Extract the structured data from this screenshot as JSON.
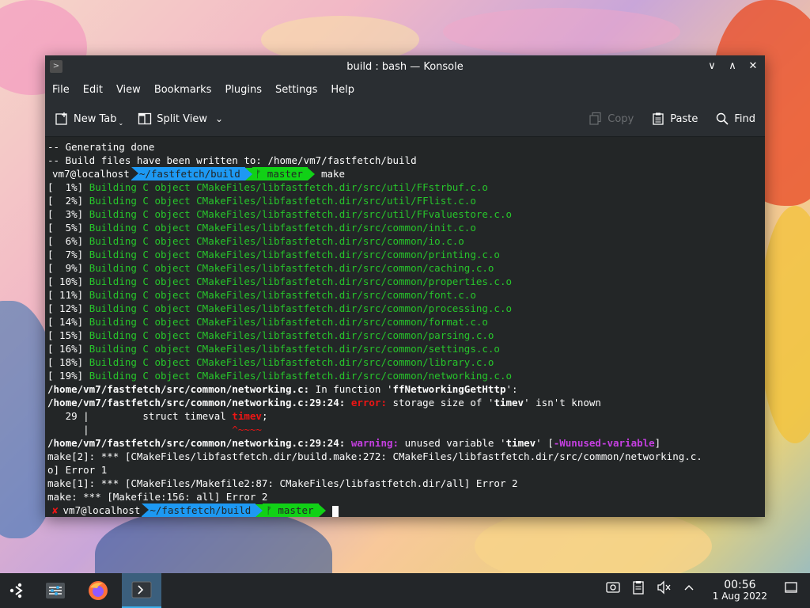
{
  "window": {
    "title": "build : bash — Konsole",
    "controls": [
      "∨",
      "∧",
      "✕"
    ]
  },
  "menu": [
    "File",
    "Edit",
    "View",
    "Bookmarks",
    "Plugins",
    "Settings",
    "Help"
  ],
  "toolbar": {
    "new_tab": "New Tab",
    "split_view": "Split View",
    "copy": "Copy",
    "paste": "Paste",
    "find": "Find"
  },
  "terminal": {
    "pre_lines": [
      "-- Generating done",
      "-- Build files have been written to: /home/vm7/fastfetch/build"
    ],
    "prompt1": {
      "user": "vm7@localhost",
      "dir": "~/fastfetch/build",
      "git": "ᚠ master",
      "cmd": "make"
    },
    "build_lines": [
      {
        "pct": "[  1%]",
        "text": "Building C object CMakeFiles/libfastfetch.dir/src/util/FFstrbuf.c.o"
      },
      {
        "pct": "[  2%]",
        "text": "Building C object CMakeFiles/libfastfetch.dir/src/util/FFlist.c.o"
      },
      {
        "pct": "[  3%]",
        "text": "Building C object CMakeFiles/libfastfetch.dir/src/util/FFvaluestore.c.o"
      },
      {
        "pct": "[  5%]",
        "text": "Building C object CMakeFiles/libfastfetch.dir/src/common/init.c.o"
      },
      {
        "pct": "[  6%]",
        "text": "Building C object CMakeFiles/libfastfetch.dir/src/common/io.c.o"
      },
      {
        "pct": "[  7%]",
        "text": "Building C object CMakeFiles/libfastfetch.dir/src/common/printing.c.o"
      },
      {
        "pct": "[  9%]",
        "text": "Building C object CMakeFiles/libfastfetch.dir/src/common/caching.c.o"
      },
      {
        "pct": "[ 10%]",
        "text": "Building C object CMakeFiles/libfastfetch.dir/src/common/properties.c.o"
      },
      {
        "pct": "[ 11%]",
        "text": "Building C object CMakeFiles/libfastfetch.dir/src/common/font.c.o"
      },
      {
        "pct": "[ 12%]",
        "text": "Building C object CMakeFiles/libfastfetch.dir/src/common/processing.c.o"
      },
      {
        "pct": "[ 14%]",
        "text": "Building C object CMakeFiles/libfastfetch.dir/src/common/format.c.o"
      },
      {
        "pct": "[ 15%]",
        "text": "Building C object CMakeFiles/libfastfetch.dir/src/common/parsing.c.o"
      },
      {
        "pct": "[ 16%]",
        "text": "Building C object CMakeFiles/libfastfetch.dir/src/common/settings.c.o"
      },
      {
        "pct": "[ 18%]",
        "text": "Building C object CMakeFiles/libfastfetch.dir/src/common/library.c.o"
      },
      {
        "pct": "[ 19%]",
        "text": "Building C object CMakeFiles/libfastfetch.dir/src/common/networking.c.o"
      }
    ],
    "in_function": {
      "file": "/home/vm7/fastfetch/src/common/networking.c:",
      "mid": " In function '",
      "fn": "ffNetworkingGetHttp",
      "end": "':"
    },
    "error_line": {
      "loc": "/home/vm7/fastfetch/src/common/networking.c:29:24:",
      "label": "error:",
      "msg1": " storage size of '",
      "var": "timev",
      "msg2": "' isn't known"
    },
    "code_line": {
      "prefix": "   29 |         struct timeval ",
      "var": "timev",
      "suffix": ";"
    },
    "caret_line": {
      "prefix": "      |                        ",
      "caret": "^~~~~"
    },
    "warning_line": {
      "loc": "/home/vm7/fastfetch/src/common/networking.c:29:24:",
      "label": "warning:",
      "msg1": " unused variable '",
      "var": "timev",
      "msg2": "' [",
      "flag": "-Wunused-variable",
      "end": "]"
    },
    "make_lines": [
      "make[2]: *** [CMakeFiles/libfastfetch.dir/build.make:272: CMakeFiles/libfastfetch.dir/src/common/networking.c.",
      "o] Error 1",
      "make[1]: *** [CMakeFiles/Makefile2:87: CMakeFiles/libfastfetch.dir/all] Error 2",
      "make: *** [Makefile:156: all] Error 2"
    ],
    "prompt2": {
      "status": "✘",
      "user": "vm7@localhost",
      "dir": "~/fastfetch/build",
      "git": "ᚠ master"
    }
  },
  "taskbar": {
    "clock_time": "00:56",
    "clock_date": "1 Aug 2022"
  },
  "colors": {
    "accent": "#3daee9",
    "prompt_dir": "#1d99f3",
    "prompt_git": "#11d116",
    "build_green": "#27c62b",
    "error_red": "#ed1515",
    "warning_magenta": "#c43fe0"
  }
}
